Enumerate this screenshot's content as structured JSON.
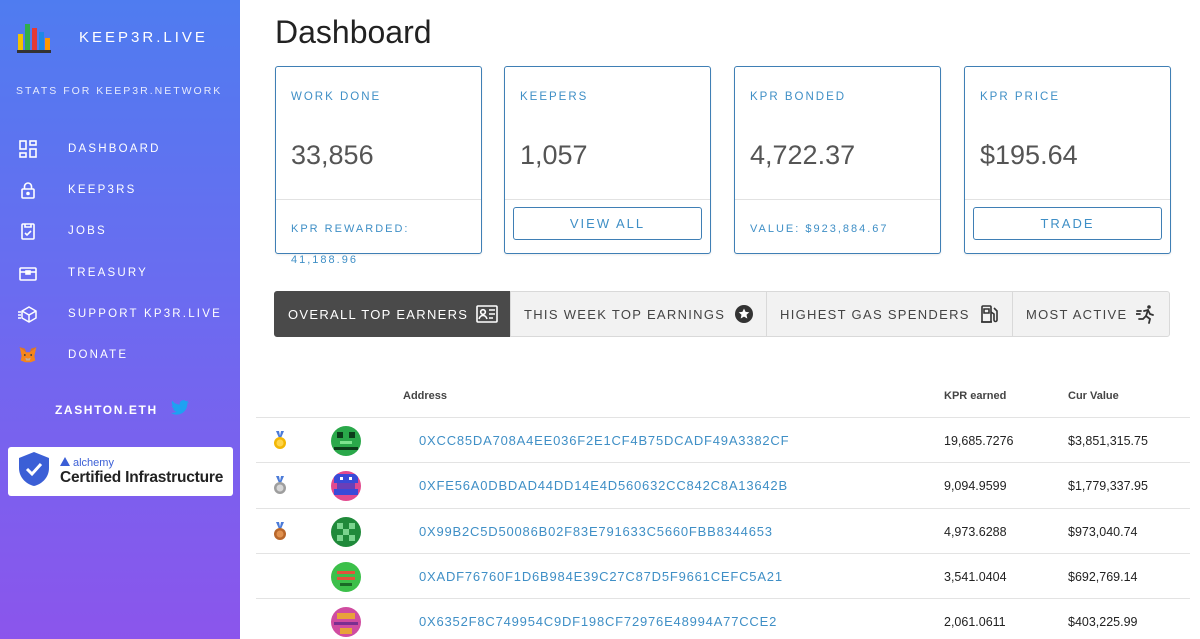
{
  "sidebar": {
    "brand_title": "KEEP3R.LIVE",
    "tagline": "STATS FOR KEEP3R.NETWORK",
    "items": [
      {
        "label": "DASHBOARD",
        "icon": "dashboard-grid-icon"
      },
      {
        "label": "KEEP3RS",
        "icon": "lock-icon"
      },
      {
        "label": "JOBS",
        "icon": "jobs-clipboard-icon"
      },
      {
        "label": "TREASURY",
        "icon": "treasury-box-icon"
      },
      {
        "label": "SUPPORT KP3R.LIVE",
        "icon": "cube-icon"
      },
      {
        "label": "DONATE",
        "icon": "metamask-fox-icon"
      }
    ],
    "author": "ZASHTON.ETH",
    "alchemy": {
      "brand": "alchemy",
      "badge": "Certified Infrastructure"
    }
  },
  "main": {
    "title": "Dashboard",
    "cards": [
      {
        "label": "WORK DONE",
        "value": "33,856",
        "footer_line1": "KPR REWARDED:",
        "footer_line2": "41,188.96"
      },
      {
        "label": "KEEPERS",
        "value": "1,057",
        "button": "VIEW ALL"
      },
      {
        "label": "KPR BONDED",
        "value": "4,722.37",
        "footer_line1": "VALUE: $923,884.67"
      },
      {
        "label": "KPR PRICE",
        "value": "$195.64",
        "button": "TRADE"
      }
    ],
    "tabs": [
      {
        "label": "OVERALL TOP EARNERS",
        "icon": "leaderboard-icon",
        "active": true
      },
      {
        "label": "THIS WEEK TOP EARNINGS",
        "icon": "star-circle-icon",
        "active": false
      },
      {
        "label": "HIGHEST GAS SPENDERS",
        "icon": "gas-pump-icon",
        "active": false
      },
      {
        "label": "MOST ACTIVE",
        "icon": "running-icon",
        "active": false
      }
    ],
    "table": {
      "headers": {
        "address": "Address",
        "kpr": "KPR earned",
        "value": "Cur Value"
      },
      "rows": [
        {
          "medal": "gold",
          "address": "0XCC85DA708A4EE036F2E1CF4B75DCADF49A3382CF",
          "kpr": "19,685.7276",
          "value": "$3,851,315.75",
          "avatar_color": "#2aa84a"
        },
        {
          "medal": "silver",
          "address": "0XFE56A0DBDAD44DD14E4D560632CC842C8A13642B",
          "kpr": "9,094.9599",
          "value": "$1,779,337.95",
          "avatar_color": "#6a3fb8"
        },
        {
          "medal": "bronze",
          "address": "0X99B2C5D50086B02F83E791633C5660FBB8344653",
          "kpr": "4,973.6288",
          "value": "$973,040.74",
          "avatar_color": "#1f8a3a"
        },
        {
          "medal": "",
          "address": "0XADF76760F1D6B984E39C27C87D5F9661CEFC5A21",
          "kpr": "3,541.0404",
          "value": "$692,769.14",
          "avatar_color": "#3cc04a"
        },
        {
          "medal": "",
          "address": "0X6352F8C749954C9DF198CF72976E48994A77CCE2",
          "kpr": "2,061.0611",
          "value": "$403,225.99",
          "avatar_color": "#d04ca0"
        }
      ]
    }
  }
}
